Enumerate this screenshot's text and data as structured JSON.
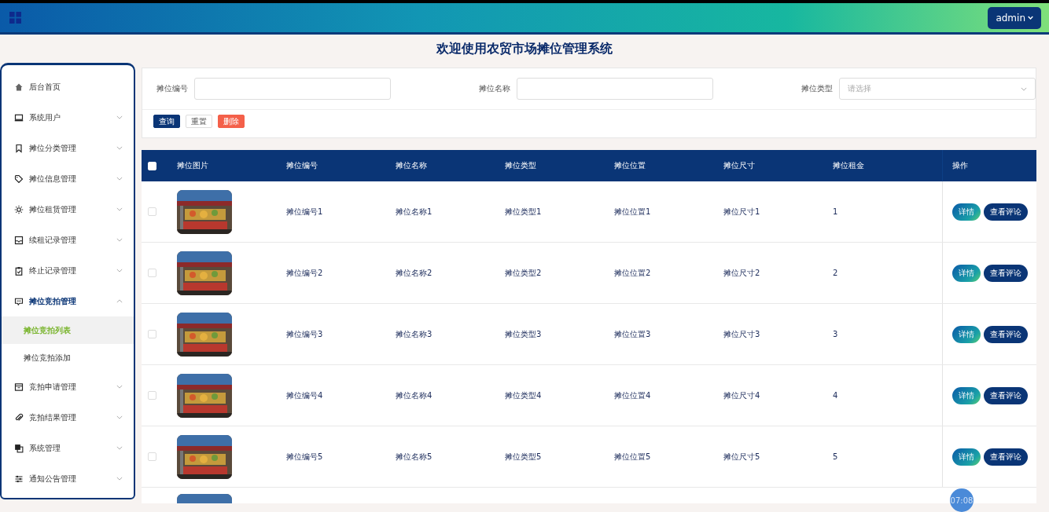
{
  "header": {
    "user_menu": "admin"
  },
  "page_title": "欢迎使用农贸市场摊位管理系统",
  "sidebar": {
    "items": [
      {
        "label": "后台首页",
        "expandable": false,
        "expanded": false,
        "selected": false
      },
      {
        "label": "系统用户",
        "expandable": true,
        "expanded": false,
        "selected": false
      },
      {
        "label": "摊位分类管理",
        "expandable": true,
        "expanded": false,
        "selected": false
      },
      {
        "label": "摊位信息管理",
        "expandable": true,
        "expanded": false,
        "selected": false
      },
      {
        "label": "摊位租赁管理",
        "expandable": true,
        "expanded": false,
        "selected": false
      },
      {
        "label": "续租记录管理",
        "expandable": true,
        "expanded": false,
        "selected": false
      },
      {
        "label": "终止记录管理",
        "expandable": true,
        "expanded": false,
        "selected": false
      },
      {
        "label": "摊位竞拍管理",
        "expandable": true,
        "expanded": true,
        "selected": false,
        "children": [
          {
            "label": "摊位竞拍列表",
            "selected": true
          },
          {
            "label": "摊位竞拍添加",
            "selected": false
          }
        ]
      },
      {
        "label": "竞拍申请管理",
        "expandable": true,
        "expanded": false,
        "selected": false
      },
      {
        "label": "竞拍结果管理",
        "expandable": true,
        "expanded": false,
        "selected": false
      },
      {
        "label": "系统管理",
        "expandable": true,
        "expanded": false,
        "selected": false
      },
      {
        "label": "通知公告管理",
        "expandable": true,
        "expanded": false,
        "selected": false
      }
    ]
  },
  "search": {
    "fields": [
      {
        "kind": "text",
        "label": "摊位编号"
      },
      {
        "kind": "text",
        "label": "摊位名称"
      },
      {
        "kind": "select",
        "label": "摊位类型",
        "placeholder": "请选择"
      }
    ],
    "buttons": [
      {
        "label": "查询",
        "kind": "primary"
      },
      {
        "label": "重置",
        "kind": "plain"
      },
      {
        "label": "删除",
        "kind": "danger"
      }
    ]
  },
  "table": {
    "select_all": {
      "checked": false
    },
    "columns": [
      "摊位图片",
      "摊位编号",
      "摊位名称",
      "摊位类型",
      "摊位位置",
      "摊位尺寸",
      "摊位租金",
      "操作"
    ],
    "rows": [
      {
        "checked": false,
        "cells": [
          {
            "kind": "picture"
          },
          "摊位编号1",
          "摊位名称1",
          "摊位类型1",
          "摊位位置1",
          "摊位尺寸1",
          "1",
          {
            "kind": "actions",
            "buttons": [
              "详情",
              "查看评论"
            ]
          }
        ]
      },
      {
        "checked": false,
        "cells": [
          {
            "kind": "picture"
          },
          "摊位编号2",
          "摊位名称2",
          "摊位类型2",
          "摊位位置2",
          "摊位尺寸2",
          "2",
          {
            "kind": "actions",
            "buttons": [
              "详情",
              "查看评论"
            ]
          }
        ]
      },
      {
        "checked": false,
        "cells": [
          {
            "kind": "picture"
          },
          "摊位编号3",
          "摊位名称3",
          "摊位类型3",
          "摊位位置3",
          "摊位尺寸3",
          "3",
          {
            "kind": "actions",
            "buttons": [
              "详情",
              "查看评论"
            ]
          }
        ]
      },
      {
        "checked": false,
        "cells": [
          {
            "kind": "picture"
          },
          "摊位编号4",
          "摊位名称4",
          "摊位类型4",
          "摊位位置4",
          "摊位尺寸4",
          "4",
          {
            "kind": "actions",
            "buttons": [
              "详情",
              "查看评论"
            ]
          }
        ]
      },
      {
        "checked": false,
        "cells": [
          {
            "kind": "picture"
          },
          "摊位编号5",
          "摊位名称5",
          "摊位类型5",
          "摊位位置5",
          "摊位尺寸5",
          "5",
          {
            "kind": "actions",
            "buttons": [
              "详情",
              "查看评论"
            ]
          }
        ]
      }
    ],
    "partial_row": {
      "cells": [
        {
          "kind": "picture"
        }
      ]
    }
  },
  "timer_badge": "07:08"
}
